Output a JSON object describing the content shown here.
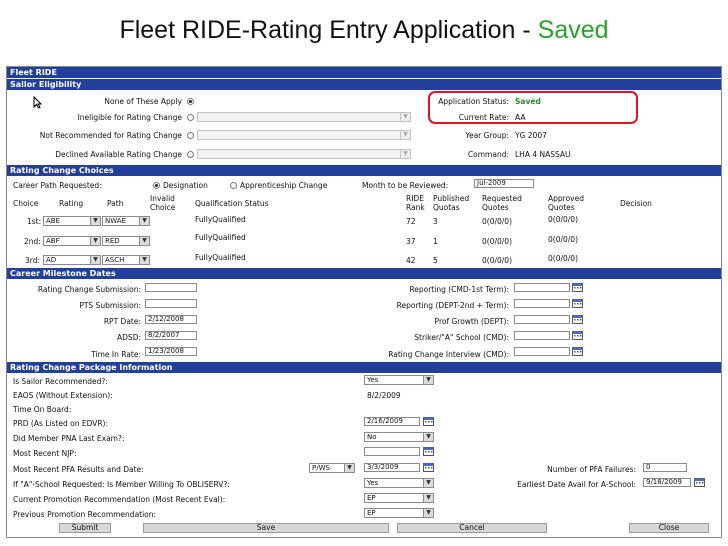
{
  "slide": {
    "title_main": "Fleet RIDE-Rating Entry Application - ",
    "title_status": "Saved"
  },
  "colors": {
    "section_header": "#223f9c",
    "saved_green": "#28a32a",
    "highlight_red": "#e0141e"
  },
  "app_title": "Fleet RIDE",
  "eligibility": {
    "header": "Sailor Eligibility",
    "options": [
      {
        "label": "None of These Apply",
        "selected": true
      },
      {
        "label": "Ineligible for Rating Change",
        "selected": false
      },
      {
        "label": "Not Recommended for Rating Change",
        "selected": false
      },
      {
        "label": "Declined Available Rating Change",
        "selected": false
      }
    ],
    "status_label": "Application Status:",
    "status_value": "Saved",
    "current_rate_label": "Current Rate:",
    "current_rate_value": "AA",
    "year_group_label": "Year Group:",
    "year_group_value": "YG 2007",
    "command_label": "Command:",
    "command_value": "LHA 4 NASSAU"
  },
  "choices": {
    "header": "Rating Change Choices",
    "career_path_label": "Career Path Requested:",
    "designation_label": "Designation",
    "apprenticeship_label": "Apprenticeship Change",
    "month_label": "Month to be Reviewed:",
    "month_value": "Jul-2009",
    "columns": [
      "Choice",
      "Rating",
      "Path",
      "Invalid Choice",
      "Qualification Status",
      "RIDE Rank",
      "Published Quotas",
      "Requested Quotes",
      "Approved Quotes",
      "Decision"
    ],
    "rows": [
      {
        "choice": "1st:",
        "rating": "ABE",
        "path": "NWAE",
        "status": "FullyQualified",
        "rank": "72",
        "published": "3",
        "requested": "0(0/0/0)",
        "approved": "0(0/0/0)"
      },
      {
        "choice": "2nd:",
        "rating": "ABF",
        "path": "RED",
        "status": "FullyQualified",
        "rank": "37",
        "published": "1",
        "requested": "0(0/0/0)",
        "approved": "0(0/0/0)"
      },
      {
        "choice": "3rd:",
        "rating": "AD",
        "path": "ASCH",
        "status": "FullyQualified",
        "rank": "42",
        "published": "5",
        "requested": "0(0/0/0)",
        "approved": "0(0/0/0)"
      }
    ]
  },
  "milestones": {
    "header": "Career Milestone Dates",
    "left": [
      {
        "label": "Rating Change Submission:",
        "value": ""
      },
      {
        "label": "PTS Submission:",
        "value": ""
      },
      {
        "label": "RPT Date:",
        "value": "2/12/2008"
      },
      {
        "label": "ADSD:",
        "value": "8/2/2007"
      },
      {
        "label": "Time In Rate:",
        "value": "1/23/2008"
      }
    ],
    "right": [
      {
        "label": "Reporting (CMD-1st Term):",
        "value": ""
      },
      {
        "label": "Reporting (DEPT-2nd + Term):",
        "value": ""
      },
      {
        "label": "Prof Growth (DEPT):",
        "value": ""
      },
      {
        "label": "Striker/\"A\" School (CMD):",
        "value": ""
      },
      {
        "label": "Rating Change Interview (CMD):",
        "value": ""
      }
    ]
  },
  "package": {
    "header": "Rating Change Package Information",
    "recommended_label": "Is Sailor Recommended?:",
    "recommended_value": "Yes",
    "eaos_label": "EAOS (Without Extension):",
    "eaos_value": "8/2/2009",
    "time_on_board_label": "Time On Board:",
    "prd_label": "PRD (As Listed on EDVR):",
    "prd_value": "2/16/2009",
    "pna_label": "Did Member PNA Last Exam?:",
    "pna_value": "No",
    "njp_label": "Most Recent NJP:",
    "njp_value": "",
    "pfa_label": "Most Recent PFA Results and Date:",
    "pfa_result": "P/WS",
    "pfa_date": "3/3/2009",
    "pfa_failures_label": "Number of PFA Failures:",
    "pfa_failures_value": "0",
    "obliserv_label": "If \"A\"-School Requested: Is Member Willing To OBLISERV?:",
    "obliserv_value": "Yes",
    "earliest_label": "Earliest Date Avail for A-School:",
    "earliest_value": "9/18/2009",
    "current_promo_label": "Current Promotion Recommendation (Most Recent Eval):",
    "current_promo_value": "EP",
    "prev_promo_label": "Previous Promotion Recommendation:",
    "prev_promo_value": "EP"
  },
  "buttons": {
    "submit": "Submit",
    "save": "Save",
    "cancel": "Cancel",
    "close": "Close"
  }
}
